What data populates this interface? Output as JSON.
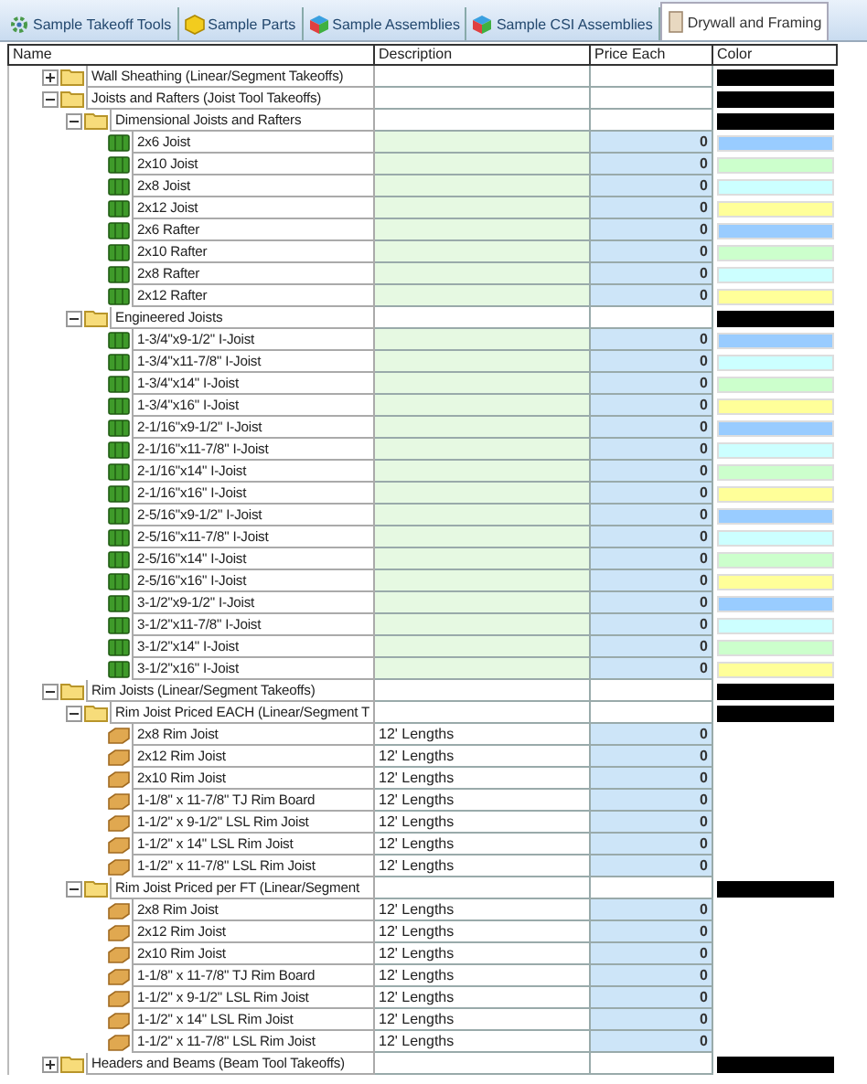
{
  "tabs": [
    {
      "label": "Sample Takeoff Tools",
      "selected": false
    },
    {
      "label": "Sample Parts",
      "selected": false
    },
    {
      "label": "Sample Assemblies",
      "selected": false
    },
    {
      "label": "Sample CSI Assemblies",
      "selected": false
    },
    {
      "label": "Drywall and Framing",
      "selected": true
    }
  ],
  "table": {
    "columns": [
      "Name",
      "Description",
      "Price Each",
      "Color"
    ],
    "tree": [
      {
        "kind": "folder",
        "name": "Wall Sheathing (Linear/Segment Takeoffs)",
        "color": "#000000",
        "expanded": false
      },
      {
        "kind": "folder",
        "name": "Joists and Rafters (Joist Tool Takeoffs)",
        "color": "#000000",
        "expanded": true,
        "children": [
          {
            "kind": "folder",
            "name": "Dimensional Joists and Rafters",
            "color": "#000000",
            "expanded": true,
            "children": [
              {
                "kind": "joist",
                "name": "2x6 Joist",
                "price": "0",
                "color": "#99ccff"
              },
              {
                "kind": "joist",
                "name": "2x10 Joist",
                "price": "0",
                "color": "#ccffcc"
              },
              {
                "kind": "joist",
                "name": "2x8 Joist",
                "price": "0",
                "color": "#ccffff"
              },
              {
                "kind": "joist",
                "name": "2x12 Joist",
                "price": "0",
                "color": "#ffff99"
              },
              {
                "kind": "joist",
                "name": "2x6 Rafter",
                "price": "0",
                "color": "#99ccff"
              },
              {
                "kind": "joist",
                "name": "2x10 Rafter",
                "price": "0",
                "color": "#ccffcc"
              },
              {
                "kind": "joist",
                "name": "2x8 Rafter",
                "price": "0",
                "color": "#ccffff"
              },
              {
                "kind": "joist",
                "name": "2x12 Rafter",
                "price": "0",
                "color": "#ffff99"
              }
            ]
          },
          {
            "kind": "folder",
            "name": "Engineered Joists",
            "color": "#000000",
            "expanded": true,
            "children": [
              {
                "kind": "joist",
                "name": "1-3/4\"x9-1/2\" I-Joist",
                "price": "0",
                "color": "#99ccff"
              },
              {
                "kind": "joist",
                "name": "1-3/4\"x11-7/8\" I-Joist",
                "price": "0",
                "color": "#ccffff"
              },
              {
                "kind": "joist",
                "name": "1-3/4\"x14\" I-Joist",
                "price": "0",
                "color": "#ccffcc"
              },
              {
                "kind": "joist",
                "name": "1-3/4\"x16\" I-Joist",
                "price": "0",
                "color": "#ffff99"
              },
              {
                "kind": "joist",
                "name": "2-1/16\"x9-1/2\" I-Joist",
                "price": "0",
                "color": "#99ccff"
              },
              {
                "kind": "joist",
                "name": "2-1/16\"x11-7/8\" I-Joist",
                "price": "0",
                "color": "#ccffff"
              },
              {
                "kind": "joist",
                "name": "2-1/16\"x14\" I-Joist",
                "price": "0",
                "color": "#ccffcc"
              },
              {
                "kind": "joist",
                "name": "2-1/16\"x16\" I-Joist",
                "price": "0",
                "color": "#ffff99"
              },
              {
                "kind": "joist",
                "name": "2-5/16\"x9-1/2\" I-Joist",
                "price": "0",
                "color": "#99ccff"
              },
              {
                "kind": "joist",
                "name": "2-5/16\"x11-7/8\" I-Joist",
                "price": "0",
                "color": "#ccffff"
              },
              {
                "kind": "joist",
                "name": "2-5/16\"x14\" I-Joist",
                "price": "0",
                "color": "#ccffcc"
              },
              {
                "kind": "joist",
                "name": "2-5/16\"x16\" I-Joist",
                "price": "0",
                "color": "#ffff99"
              },
              {
                "kind": "joist",
                "name": "3-1/2\"x9-1/2\" I-Joist",
                "price": "0",
                "color": "#99ccff"
              },
              {
                "kind": "joist",
                "name": "3-1/2\"x11-7/8\" I-Joist",
                "price": "0",
                "color": "#ccffff"
              },
              {
                "kind": "joist",
                "name": "3-1/2\"x14\" I-Joist",
                "price": "0",
                "color": "#ccffcc"
              },
              {
                "kind": "joist",
                "name": "3-1/2\"x16\" I-Joist",
                "price": "0",
                "color": "#ffff99"
              }
            ]
          }
        ]
      },
      {
        "kind": "folder",
        "name": "Rim Joists (Linear/Segment Takeoffs)",
        "color": "#000000",
        "expanded": true,
        "children": [
          {
            "kind": "folder",
            "name": "Rim Joist Priced EACH (Linear/Segment T",
            "color": "#000000",
            "expanded": true,
            "children": [
              {
                "kind": "rim",
                "name": "2x8 Rim Joist",
                "description": "12' Lengths",
                "price": "0"
              },
              {
                "kind": "rim",
                "name": "2x12 Rim Joist",
                "description": "12' Lengths",
                "price": "0"
              },
              {
                "kind": "rim",
                "name": "2x10 Rim Joist",
                "description": "12' Lengths",
                "price": "0"
              },
              {
                "kind": "rim",
                "name": "1-1/8\" x 11-7/8\" TJ Rim Board",
                "description": "12' Lengths",
                "price": "0"
              },
              {
                "kind": "rim",
                "name": "1-1/2\" x 9-1/2\" LSL Rim Joist",
                "description": "12' Lengths",
                "price": "0"
              },
              {
                "kind": "rim",
                "name": "1-1/2\" x 14\" LSL Rim Joist",
                "description": "12' Lengths",
                "price": "0"
              },
              {
                "kind": "rim",
                "name": "1-1/2\" x 11-7/8\" LSL Rim Joist",
                "description": "12' Lengths",
                "price": "0"
              }
            ]
          },
          {
            "kind": "folder",
            "name": "Rim Joist Priced per FT (Linear/Segment",
            "color": "#000000",
            "expanded": true,
            "children": [
              {
                "kind": "rim",
                "name": "2x8 Rim Joist",
                "description": "12' Lengths",
                "price": "0"
              },
              {
                "kind": "rim",
                "name": "2x12 Rim Joist",
                "description": "12' Lengths",
                "price": "0"
              },
              {
                "kind": "rim",
                "name": "2x10 Rim Joist",
                "description": "12' Lengths",
                "price": "0"
              },
              {
                "kind": "rim",
                "name": "1-1/8\" x 11-7/8\" TJ Rim Board",
                "description": "12' Lengths",
                "price": "0"
              },
              {
                "kind": "rim",
                "name": "1-1/2\" x 9-1/2\" LSL Rim Joist",
                "description": "12' Lengths",
                "price": "0"
              },
              {
                "kind": "rim",
                "name": "1-1/2\" x 14\" LSL Rim Joist",
                "description": "12' Lengths",
                "price": "0"
              },
              {
                "kind": "rim",
                "name": "1-1/2\" x 11-7/8\" LSL Rim Joist",
                "description": "12' Lengths",
                "price": "0"
              }
            ]
          }
        ]
      },
      {
        "kind": "folder",
        "name": "Headers and Beams (Beam Tool Takeoffs)",
        "color": "#000000",
        "expanded": false
      }
    ]
  }
}
